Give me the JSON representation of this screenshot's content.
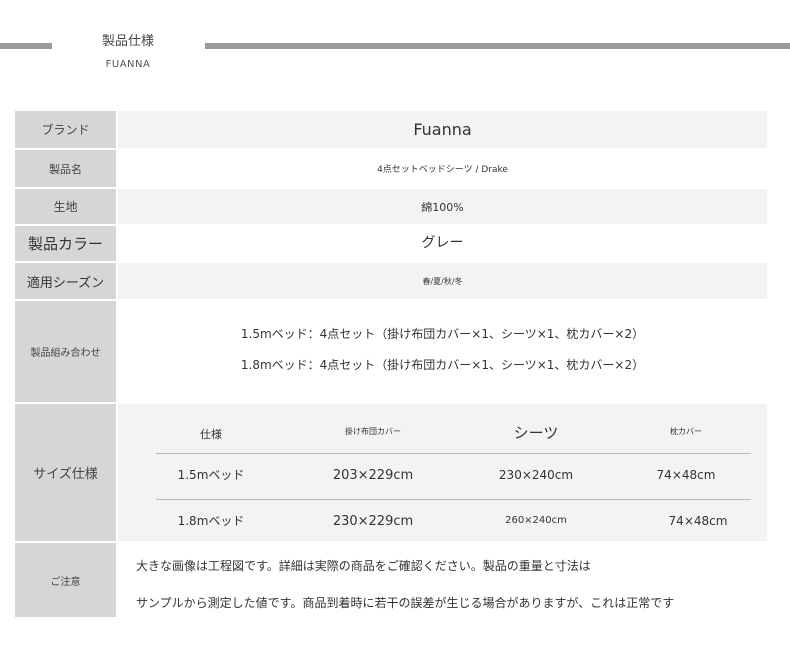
{
  "header": {
    "title": "製品仕様",
    "subtitle": "FUANNA"
  },
  "spec": {
    "brand": {
      "label": "ブランド",
      "value": "Fuanna"
    },
    "product_name": {
      "label": "製品名",
      "value": "4点セットベッドシーツ / Drake"
    },
    "fabric": {
      "label": "生地",
      "value": "綿100%"
    },
    "color": {
      "label": "製品カラー",
      "value": "グレー"
    },
    "season": {
      "label": "適用シーズン",
      "value": "春/夏/秋/冬"
    },
    "combination": {
      "label": "製品組み合わせ",
      "lines": [
        "1.5mベッド：4点セット（掛け布団カバー×1、シーツ×1、枕カバー×2）",
        "1.8mベッド：4点セット（掛け布団カバー×1、シーツ×1、枕カバー×2）"
      ]
    },
    "size": {
      "label": "サイズ仕様",
      "headers": [
        "仕様",
        "掛け布団カバー",
        "シーツ",
        "枕カバー"
      ],
      "rows": [
        [
          "1.5mベッド",
          "203×229cm",
          "230×240cm",
          "74×48cm"
        ],
        [
          "1.8mベッド",
          "230×229cm",
          "260×240cm",
          "74×48cm"
        ]
      ]
    },
    "notice": {
      "label": "ご注意",
      "lines": [
        "大きな画像は工程図です。詳細は実際の商品をご確認ください。製品の重量と寸法は",
        "サンプルから測定した値です。商品到着時に若干の誤差が生じる場合がありますが、これは正常です"
      ]
    }
  }
}
